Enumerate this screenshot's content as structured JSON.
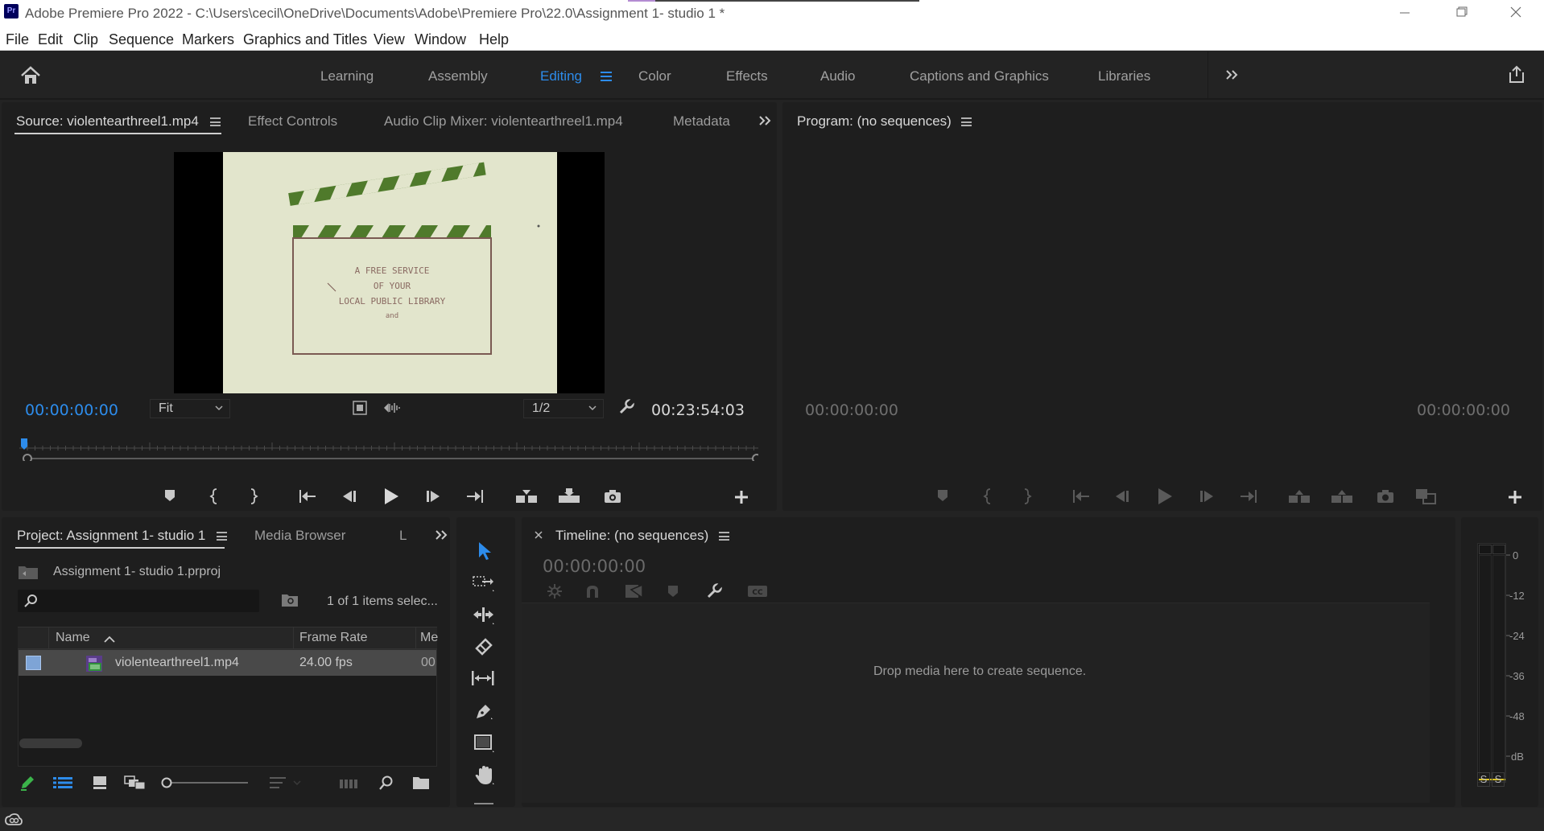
{
  "window": {
    "app_icon_text": "Pr",
    "title": "Adobe Premiere Pro 2022 - C:\\Users\\cecil\\OneDrive\\Documents\\Adobe\\Premiere Pro\\22.0\\Assignment 1- studio 1 *"
  },
  "menu": [
    "File",
    "Edit",
    "Clip",
    "Sequence",
    "Markers",
    "Graphics and Titles",
    "View",
    "Window",
    "Help"
  ],
  "workspaces": {
    "items": [
      "Learning",
      "Assembly",
      "Editing",
      "Color",
      "Effects",
      "Audio",
      "Captions and Graphics",
      "Libraries"
    ],
    "active": "Editing"
  },
  "source_panel": {
    "tabs": [
      "Source: violentearthreel1.mp4",
      "Effect Controls",
      "Audio Clip Mixer: violentearthreel1.mp4",
      "Metadata"
    ],
    "current_timecode": "00:00:00:00",
    "zoom": "Fit",
    "resolution": "1/2",
    "duration": "00:23:54:03",
    "frame_text": [
      "A FREE SERVICE",
      "OF YOUR",
      "LOCAL PUBLIC LIBRARY",
      "and"
    ]
  },
  "program_panel": {
    "tab": "Program: (no sequences)",
    "timecode_left": "00:00:00:00",
    "timecode_right": "00:00:00:00"
  },
  "project_panel": {
    "tabs": [
      "Project: Assignment 1- studio 1",
      "Media Browser",
      "L"
    ],
    "project_file": "Assignment 1- studio 1.prproj",
    "search_placeholder": "",
    "selection_count": "1 of 1 items selec...",
    "columns": [
      "Name",
      "Frame Rate",
      "Me"
    ],
    "rows": [
      {
        "name": "violentearthreel1.mp4",
        "frame_rate": "24.00 fps",
        "media": "00"
      }
    ]
  },
  "timeline_panel": {
    "tab": "Timeline: (no sequences)",
    "timecode": "00:00:00:00",
    "drop_hint": "Drop media here to create sequence."
  },
  "audio_meter": {
    "scale": [
      "0",
      "-12",
      "-24",
      "-36",
      "-48",
      "dB"
    ],
    "solo_buttons": [
      "S",
      "S"
    ]
  },
  "colors": {
    "accent_blue": "#2d8ceb",
    "panel_bg": "#1e1e1e",
    "app_bg": "#232323",
    "clip_green": "#4f7a2b"
  }
}
